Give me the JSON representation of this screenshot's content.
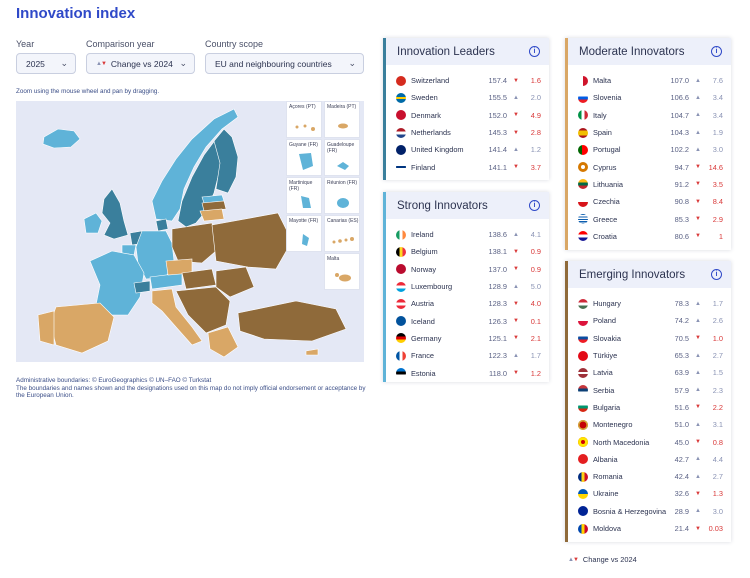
{
  "page": {
    "title": "Innovation index"
  },
  "controls": {
    "year": {
      "label": "Year",
      "value": "2025"
    },
    "comparison": {
      "label": "Comparison year",
      "value": "Change vs 2024"
    },
    "scope": {
      "label": "Country scope",
      "value": "EU and neighbouring countries"
    }
  },
  "map": {
    "hint": "Zoom using the mouse wheel and pan by dragging.",
    "insets": [
      "Açores (PT)",
      "Madeira (PT)",
      "Guyane (FR)",
      "Guadeloupe (FR)",
      "Martinique (FR)",
      "Réunion (FR)",
      "Mayotte (FR)",
      "Canarias (ES)",
      "Malta"
    ],
    "credits_1": "Administrative boundaries: © EuroGeographics © UN–FAO © Turkstat",
    "credits_2": "The boundaries and names shown and the designations used on this map do not imply official endorsement or acceptance by the European Union.",
    "colors": {
      "leader": "#3a7f9c",
      "strong": "#5fb3d8",
      "moderate": "#d9a766",
      "emerging": "#8f6a3a"
    }
  },
  "panels": {
    "leaders": {
      "title": "Innovation Leaders",
      "accent": "#3a7f9c",
      "rows": [
        {
          "name": "Switzerland",
          "score": "157.4",
          "dir": "down",
          "change": "1.6",
          "flag": "ch"
        },
        {
          "name": "Sweden",
          "score": "155.5",
          "dir": "up",
          "change": "2.0",
          "flag": "se"
        },
        {
          "name": "Denmark",
          "score": "152.0",
          "dir": "down",
          "change": "4.9",
          "flag": "dk"
        },
        {
          "name": "Netherlands",
          "score": "145.3",
          "dir": "down",
          "change": "2.8",
          "flag": "nl"
        },
        {
          "name": "United Kingdom",
          "score": "141.4",
          "dir": "up",
          "change": "1.2",
          "flag": "gb"
        },
        {
          "name": "Finland",
          "score": "141.1",
          "dir": "down",
          "change": "3.7",
          "flag": "fi"
        }
      ]
    },
    "strong": {
      "title": "Strong Innovators",
      "accent": "#5fb3d8",
      "rows": [
        {
          "name": "Ireland",
          "score": "138.6",
          "dir": "up",
          "change": "4.1",
          "flag": "ie"
        },
        {
          "name": "Belgium",
          "score": "138.1",
          "dir": "down",
          "change": "0.9",
          "flag": "be"
        },
        {
          "name": "Norway",
          "score": "137.0",
          "dir": "down",
          "change": "0.9",
          "flag": "no"
        },
        {
          "name": "Luxembourg",
          "score": "128.9",
          "dir": "up",
          "change": "5.0",
          "flag": "lu"
        },
        {
          "name": "Austria",
          "score": "128.3",
          "dir": "down",
          "change": "4.0",
          "flag": "at"
        },
        {
          "name": "Iceland",
          "score": "126.3",
          "dir": "down",
          "change": "0.1",
          "flag": "is"
        },
        {
          "name": "Germany",
          "score": "125.1",
          "dir": "down",
          "change": "2.1",
          "flag": "de"
        },
        {
          "name": "France",
          "score": "122.3",
          "dir": "up",
          "change": "1.7",
          "flag": "fr"
        },
        {
          "name": "Estonia",
          "score": "118.0",
          "dir": "down",
          "change": "1.2",
          "flag": "ee"
        }
      ]
    },
    "moderate": {
      "title": "Moderate Innovators",
      "accent": "#d9a766",
      "rows": [
        {
          "name": "Malta",
          "score": "107.0",
          "dir": "up",
          "change": "7.6",
          "flag": "mt"
        },
        {
          "name": "Slovenia",
          "score": "106.6",
          "dir": "up",
          "change": "3.4",
          "flag": "si"
        },
        {
          "name": "Italy",
          "score": "104.7",
          "dir": "up",
          "change": "3.4",
          "flag": "it"
        },
        {
          "name": "Spain",
          "score": "104.3",
          "dir": "up",
          "change": "1.9",
          "flag": "es"
        },
        {
          "name": "Portugal",
          "score": "102.2",
          "dir": "up",
          "change": "3.0",
          "flag": "pt"
        },
        {
          "name": "Cyprus",
          "score": "94.7",
          "dir": "down",
          "change": "14.6",
          "flag": "cy"
        },
        {
          "name": "Lithuania",
          "score": "91.2",
          "dir": "down",
          "change": "3.5",
          "flag": "lt"
        },
        {
          "name": "Czechia",
          "score": "90.8",
          "dir": "down",
          "change": "8.4",
          "flag": "cz"
        },
        {
          "name": "Greece",
          "score": "85.3",
          "dir": "down",
          "change": "2.9",
          "flag": "gr"
        },
        {
          "name": "Croatia",
          "score": "80.6",
          "dir": "down",
          "change": "1",
          "flag": "hr"
        }
      ]
    },
    "emerging": {
      "title": "Emerging Innovators",
      "accent": "#8f6a3a",
      "rows": [
        {
          "name": "Hungary",
          "score": "78.3",
          "dir": "up",
          "change": "1.7",
          "flag": "hu"
        },
        {
          "name": "Poland",
          "score": "74.2",
          "dir": "up",
          "change": "2.6",
          "flag": "pl"
        },
        {
          "name": "Slovakia",
          "score": "70.5",
          "dir": "down",
          "change": "1.0",
          "flag": "sk"
        },
        {
          "name": "Türkiye",
          "score": "65.3",
          "dir": "up",
          "change": "2.7",
          "flag": "tr"
        },
        {
          "name": "Latvia",
          "score": "63.9",
          "dir": "up",
          "change": "1.5",
          "flag": "lv"
        },
        {
          "name": "Serbia",
          "score": "57.9",
          "dir": "up",
          "change": "2.3",
          "flag": "rs"
        },
        {
          "name": "Bulgaria",
          "score": "51.6",
          "dir": "down",
          "change": "2.2",
          "flag": "bg"
        },
        {
          "name": "Montenegro",
          "score": "51.0",
          "dir": "up",
          "change": "3.1",
          "flag": "me"
        },
        {
          "name": "North Macedonia",
          "score": "45.0",
          "dir": "down",
          "change": "0.8",
          "flag": "mk"
        },
        {
          "name": "Albania",
          "score": "42.7",
          "dir": "up",
          "change": "4.4",
          "flag": "al"
        },
        {
          "name": "Romania",
          "score": "42.4",
          "dir": "up",
          "change": "2.7",
          "flag": "ro"
        },
        {
          "name": "Ukraine",
          "score": "32.6",
          "dir": "down",
          "change": "1.3",
          "flag": "ua"
        },
        {
          "name": "Bosnia & Herzegovina",
          "score": "28.9",
          "dir": "up",
          "change": "3.0",
          "flag": "ba"
        },
        {
          "name": "Moldova",
          "score": "21.4",
          "dir": "down",
          "change": "0.03",
          "flag": "md"
        }
      ]
    }
  },
  "legend": {
    "label": "Change vs 2024"
  }
}
